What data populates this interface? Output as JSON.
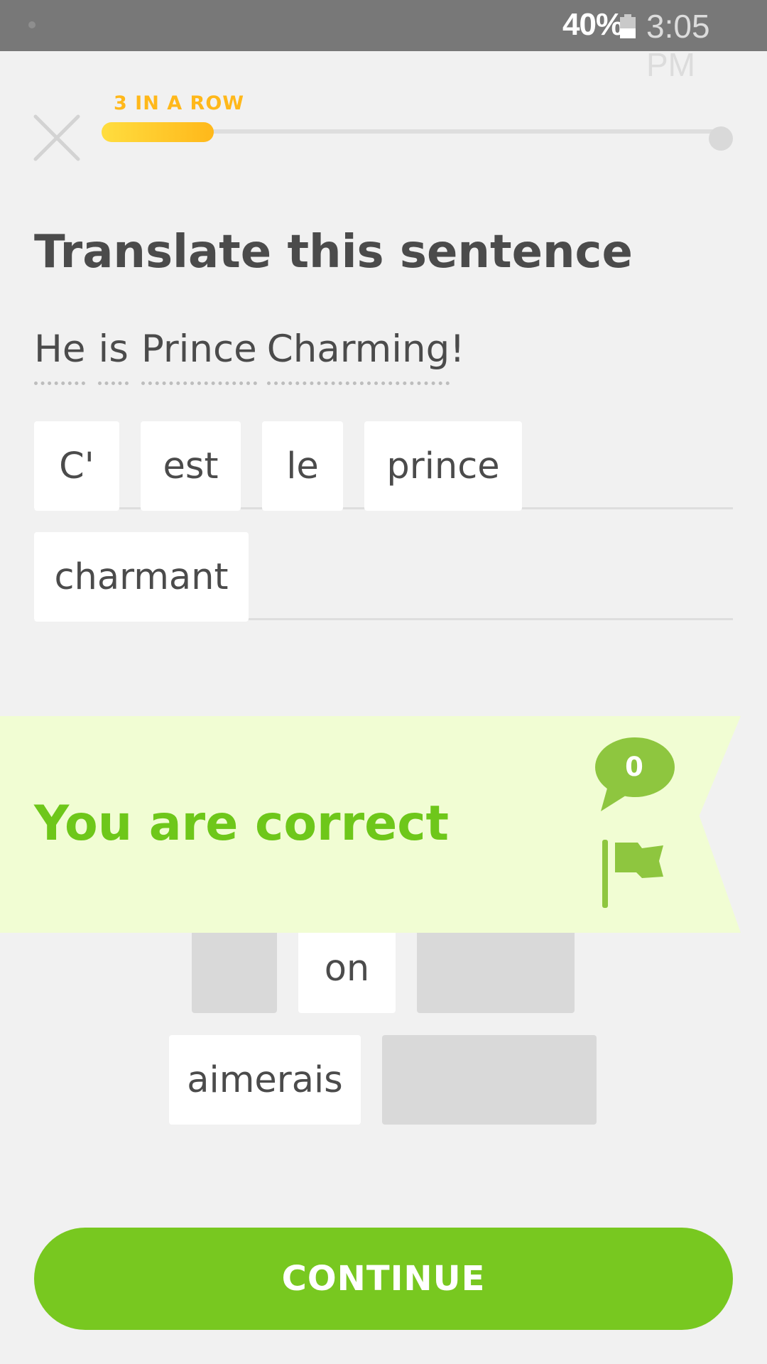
{
  "status_bar": {
    "battery_percent": "40%",
    "time": "3:05 PM"
  },
  "header": {
    "streak_label": "3 IN A ROW",
    "progress_fraction": 0.18
  },
  "exercise": {
    "title": "Translate this sentence",
    "sentence_words": [
      "He",
      "is",
      "Prince",
      "Charming"
    ],
    "sentence_punctuation": "!",
    "answer_tiles": [
      "C'",
      "est",
      "le",
      "prince",
      "charmant"
    ],
    "word_bank_visible": [
      "on",
      "aimerais"
    ]
  },
  "feedback": {
    "message": "You are correct",
    "comment_count": "0"
  },
  "actions": {
    "continue_label": "CONTINUE"
  },
  "colors": {
    "streak": "#ffb81a",
    "correct_text": "#6ec71a",
    "banner_bg": "#f1fdd3",
    "continue_bg": "#78c820"
  }
}
